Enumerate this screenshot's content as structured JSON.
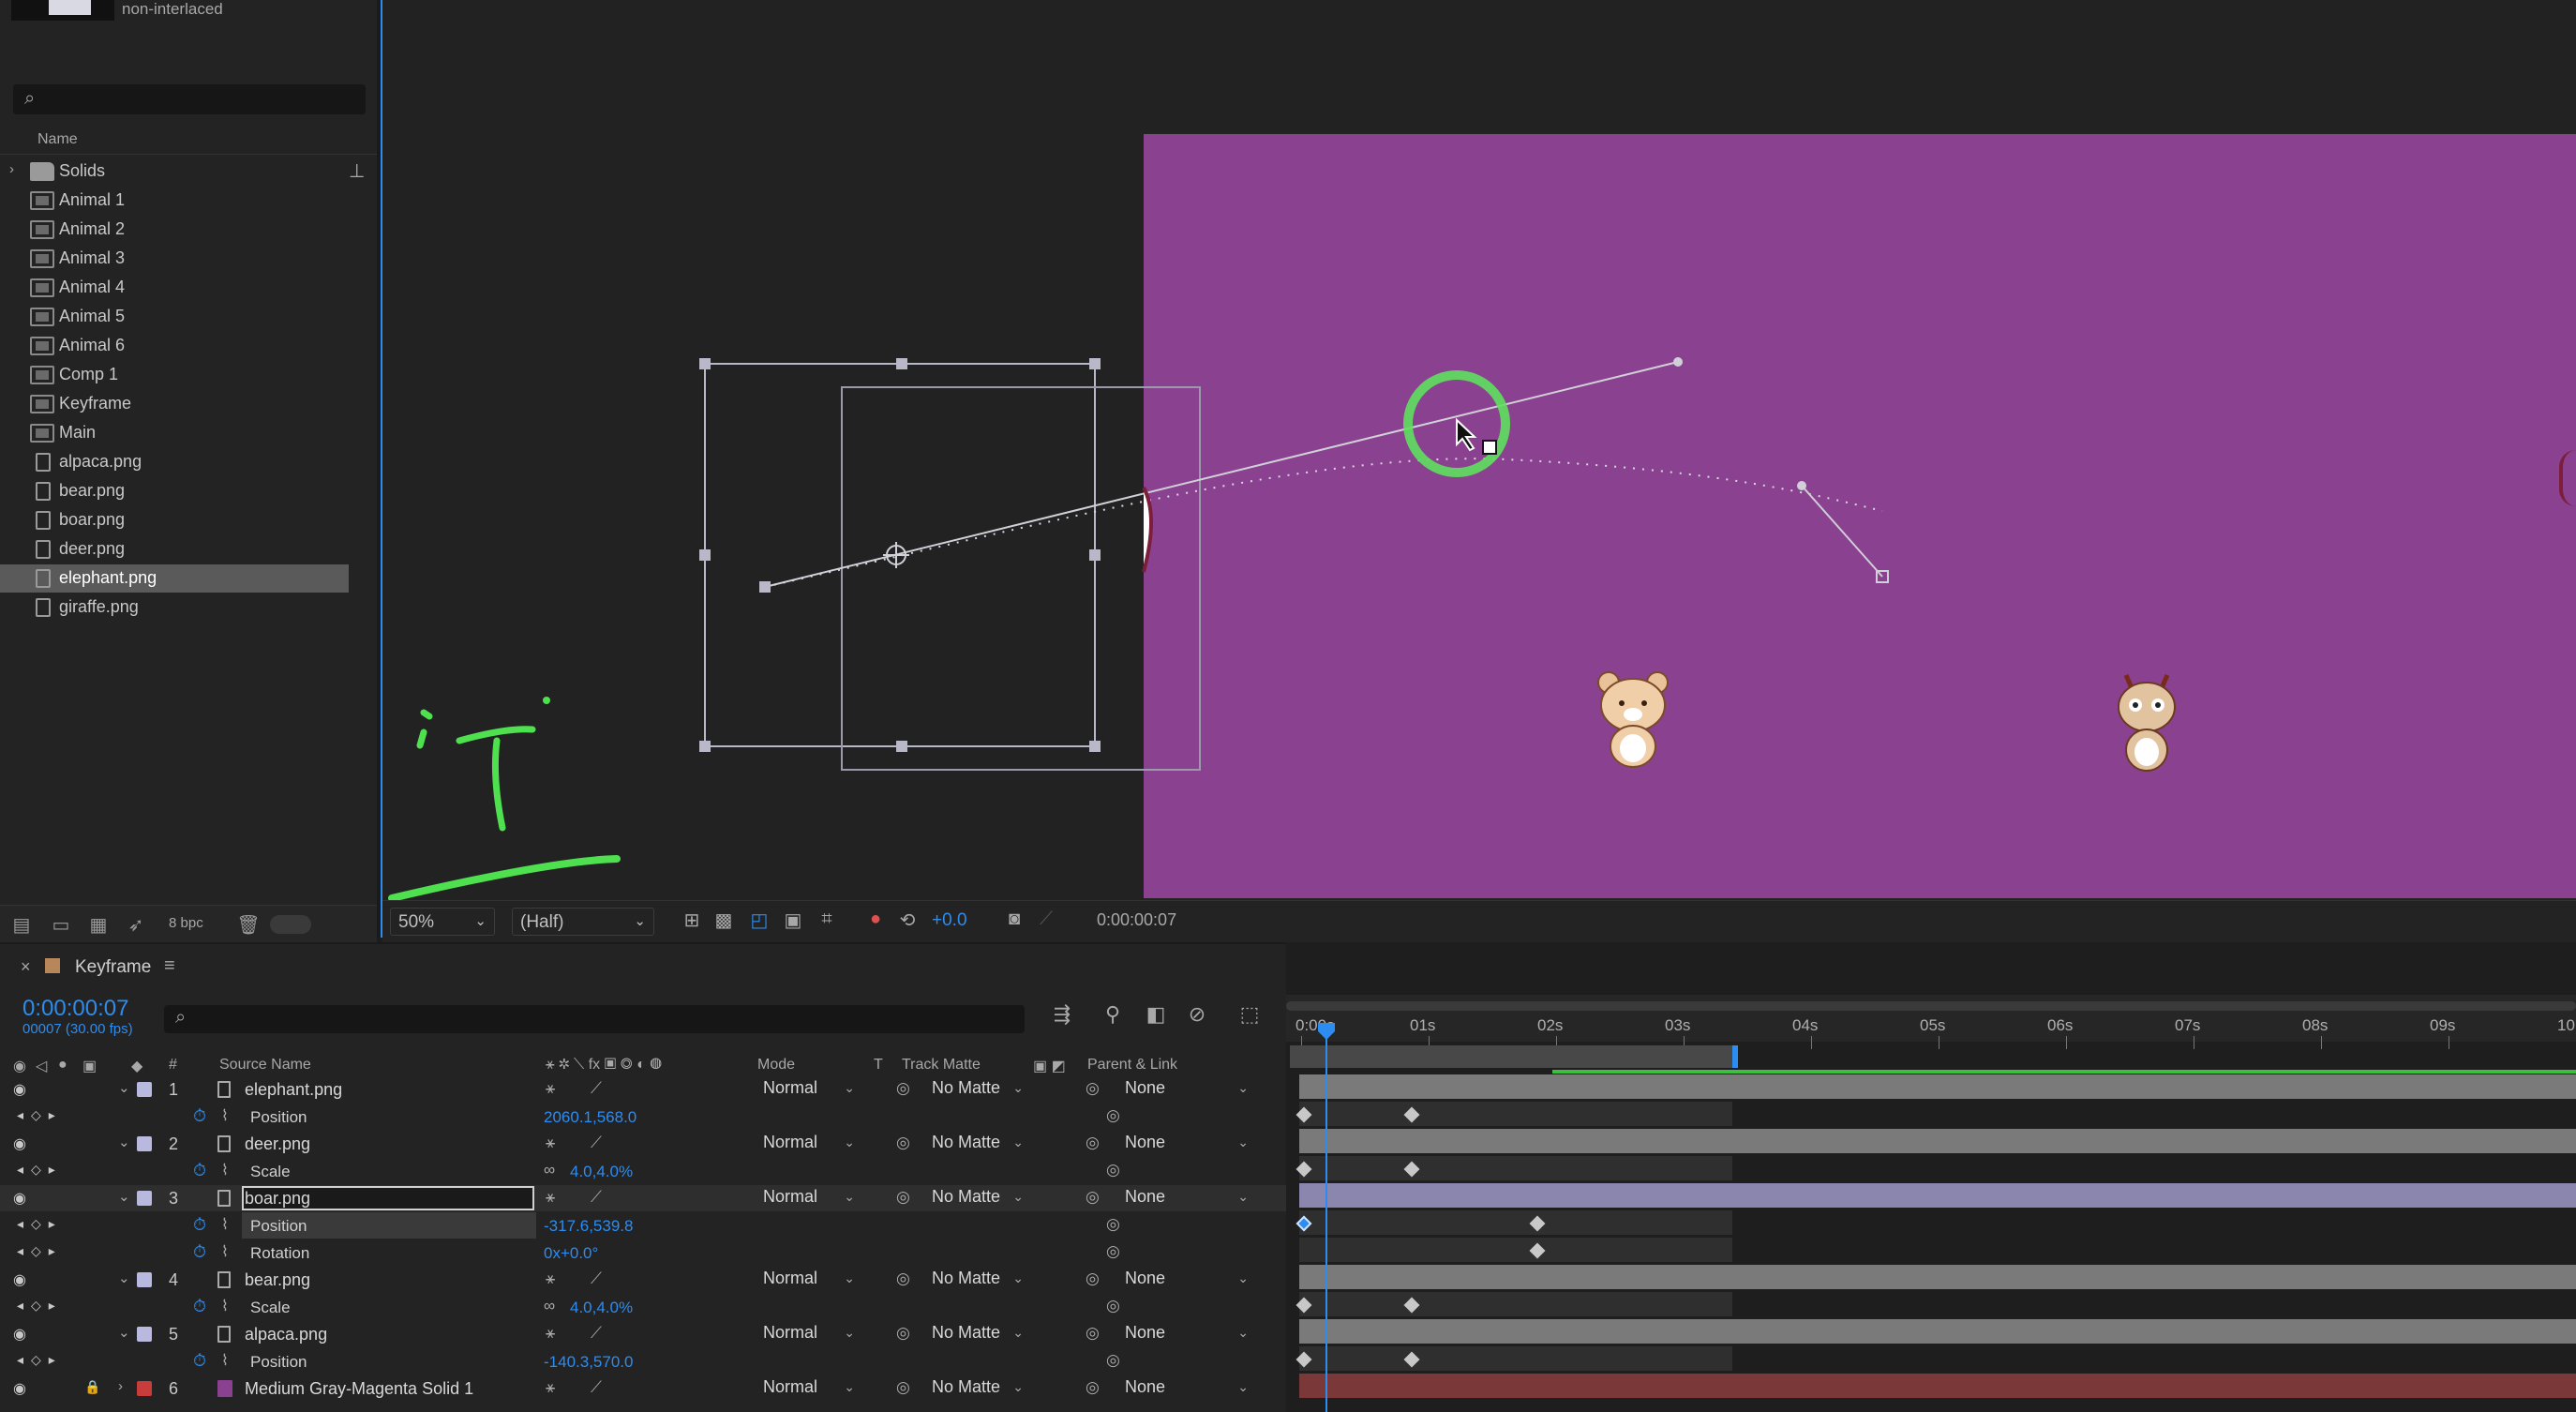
{
  "project": {
    "thumb_info": "non-interlaced",
    "search_placeholder": "",
    "col_name": "Name",
    "items": [
      {
        "label": "Solids",
        "type": "folder"
      },
      {
        "label": "Animal 1",
        "type": "comp"
      },
      {
        "label": "Animal 2",
        "type": "comp"
      },
      {
        "label": "Animal 3",
        "type": "comp"
      },
      {
        "label": "Animal 4",
        "type": "comp"
      },
      {
        "label": "Animal 5",
        "type": "comp"
      },
      {
        "label": "Animal 6",
        "type": "comp"
      },
      {
        "label": "Comp 1",
        "type": "comp"
      },
      {
        "label": "Keyframe",
        "type": "comp"
      },
      {
        "label": "Main",
        "type": "comp"
      },
      {
        "label": "alpaca.png",
        "type": "file"
      },
      {
        "label": "bear.png",
        "type": "file"
      },
      {
        "label": "boar.png",
        "type": "file"
      },
      {
        "label": "deer.png",
        "type": "file"
      },
      {
        "label": "elephant.png",
        "type": "file",
        "selected": true
      },
      {
        "label": "giraffe.png",
        "type": "file"
      }
    ],
    "bpc": "8 bpc"
  },
  "viewer": {
    "comp_bg": "#8a418f",
    "zoom": "50%",
    "resolution": "(Half)",
    "exposure": "+0.0",
    "timecode": "0:00:00:07"
  },
  "timeline": {
    "tab_name": "Keyframe",
    "timecode": "0:00:00:07",
    "frame_info": "00007 (30.00 fps)",
    "headers": {
      "source_name": "Source Name",
      "mode": "Mode",
      "t": "T",
      "track_matte": "Track Matte",
      "parent_link": "Parent & Link",
      "num": "#"
    },
    "layers": [
      {
        "num": "1",
        "name": "elephant.png",
        "mode": "Normal",
        "matte": "No Matte",
        "parent": "None",
        "prop": {
          "name": "Position",
          "value": "2060.1,568.0"
        }
      },
      {
        "num": "2",
        "name": "deer.png",
        "mode": "Normal",
        "matte": "No Matte",
        "parent": "None",
        "prop": {
          "name": "Scale",
          "value": "4.0,4.0%"
        }
      },
      {
        "num": "3",
        "name": "boar.png",
        "mode": "Normal",
        "matte": "No Matte",
        "parent": "None",
        "props": [
          {
            "name": "Position",
            "value": "-317.6,539.8"
          },
          {
            "name": "Rotation",
            "value": "0x+0.0°"
          }
        ]
      },
      {
        "num": "4",
        "name": "bear.png",
        "mode": "Normal",
        "matte": "No Matte",
        "parent": "None",
        "prop": {
          "name": "Scale",
          "value": "4.0,4.0%"
        }
      },
      {
        "num": "5",
        "name": "alpaca.png",
        "mode": "Normal",
        "matte": "No Matte",
        "parent": "None",
        "prop": {
          "name": "Position",
          "value": "-140.3,570.0"
        }
      },
      {
        "num": "6",
        "name": "Medium Gray-Magenta Solid 1",
        "mode": "Normal",
        "matte": "No Matte",
        "parent": "None"
      }
    ],
    "ruler": [
      "0:00s",
      "01s",
      "02s",
      "03s",
      "04s",
      "05s",
      "06s",
      "07s",
      "08s",
      "09s",
      "10"
    ]
  },
  "colors": {
    "accent": "#2d8cf0",
    "label_lavender": "#b9b9e0",
    "solid_label": "#c83c3c",
    "keyframe_sel": "#2d8cf0"
  }
}
